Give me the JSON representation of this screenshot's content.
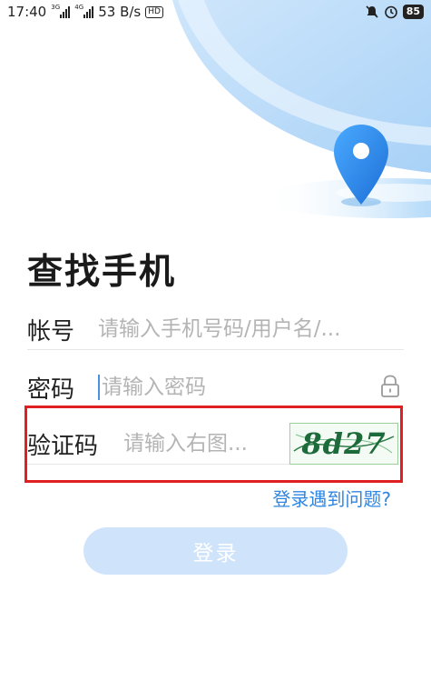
{
  "status_bar": {
    "time": "17:40",
    "sim1_network": "3G",
    "sim2_network": "4G",
    "speed": "53 B/s",
    "hd": "HD",
    "battery": "85"
  },
  "page": {
    "title": "查找手机"
  },
  "form": {
    "account_label": "帐号",
    "account_placeholder": "请输入手机号码/用户名/...",
    "password_label": "密码",
    "password_placeholder": "请输入密码",
    "captcha_label": "验证码",
    "captcha_placeholder": "请输入右图...",
    "captcha_text": "8d27"
  },
  "help_link": "登录遇到问题?",
  "login_button": "登录",
  "colors": {
    "accent": "#2f86e0",
    "button_disabled": "#cfe4fb",
    "highlight": "#e02020",
    "pin": "#2d8ef0"
  },
  "icons": [
    "do-not-disturb-icon",
    "alarm-icon",
    "lock-icon",
    "location-pin-icon"
  ]
}
